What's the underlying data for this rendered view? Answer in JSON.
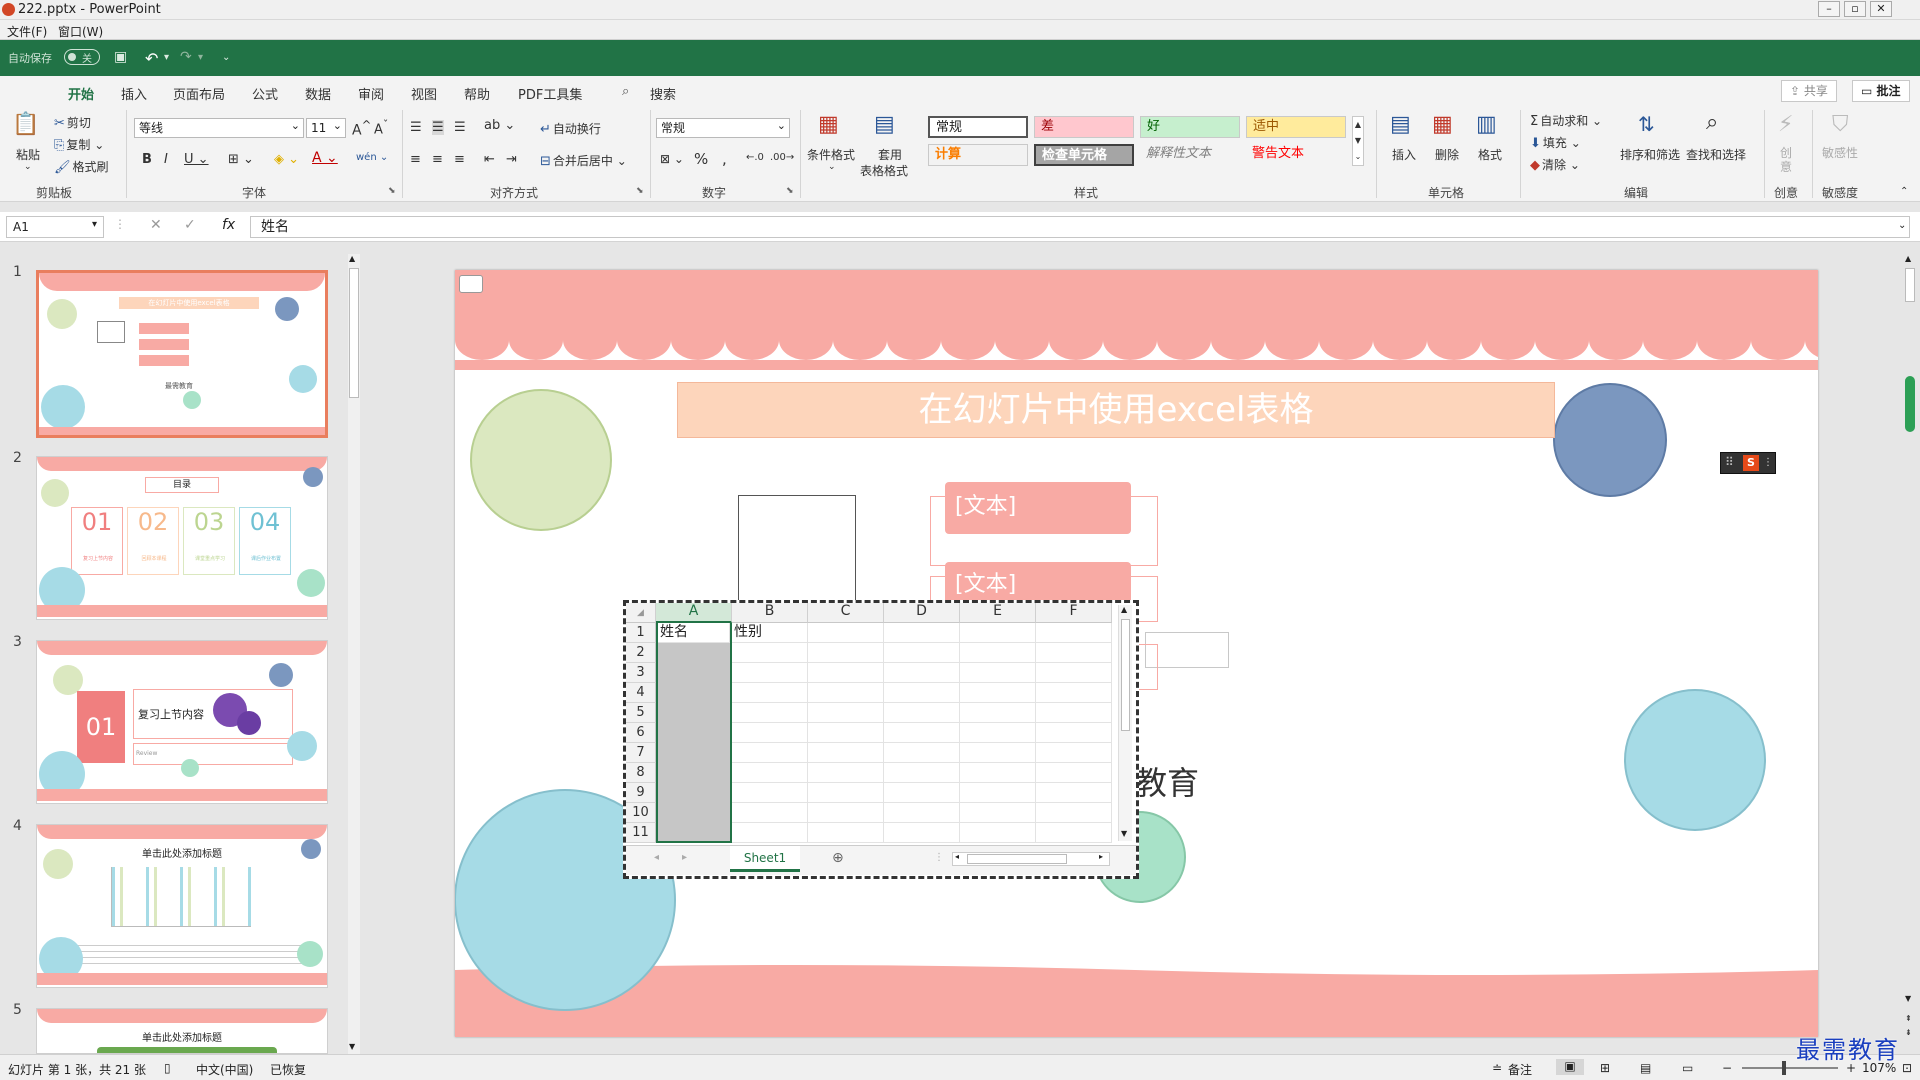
{
  "window": {
    "title": "222.pptx - PowerPoint"
  },
  "menubar": {
    "file": "文件(F)",
    "window": "窗口(W)"
  },
  "qat": {
    "autosave": "自动保存",
    "toggle": "关"
  },
  "tabs": [
    "开始",
    "插入",
    "页面布局",
    "公式",
    "数据",
    "审阅",
    "视图",
    "帮助",
    "PDF工具集"
  ],
  "search": "搜索",
  "share": "共享",
  "comments": "批注",
  "ribbon": {
    "clipboard": {
      "paste": "粘贴",
      "cut": "剪切",
      "copy": "复制",
      "painter": "格式刷",
      "label": "剪贴板"
    },
    "font": {
      "name": "等线",
      "size": "11",
      "label": "字体"
    },
    "align": {
      "wrap": "自动换行",
      "merge": "合并后居中",
      "label": "对齐方式"
    },
    "number": {
      "format": "常规",
      "label": "数字"
    },
    "styles": {
      "cond": "条件格式",
      "table1": "套用",
      "table2": "表格格式",
      "normal": "常规",
      "bad": "差",
      "good": "好",
      "neutral": "适中",
      "calc": "计算",
      "check": "检查单元格",
      "explain": "解释性文本",
      "warn": "警告文本",
      "label": "样式"
    },
    "cells": {
      "insert": "插入",
      "delete": "删除",
      "format": "格式",
      "label": "单元格"
    },
    "edit": {
      "autosum": "自动求和",
      "fill": "填充",
      "clear": "清除",
      "sort": "排序和筛选",
      "find": "查找和选择",
      "label": "编辑"
    },
    "create": {
      "btn": "创意",
      "label": "创意"
    },
    "sens": {
      "btn": "敏感性",
      "label": "敏感度"
    }
  },
  "formula": {
    "namebox": "A1",
    "value": "姓名"
  },
  "thumbs": {
    "nums": [
      "1",
      "2",
      "3",
      "4",
      "5"
    ],
    "t1": {
      "title": "在幻灯片中使用excel表格",
      "sub": "最需教育"
    },
    "t2": {
      "title": "目录",
      "n1": "01",
      "n2": "02",
      "n3": "03",
      "n4": "04",
      "c1": "复习上节内容",
      "c2": "回顾本课程",
      "c3": "课堂重点学习",
      "c4": "课后作业布置"
    },
    "t3": {
      "n": "01",
      "title": "复习上节内容",
      "sub": "Review"
    },
    "t4": {
      "title": "单击此处添加标题"
    },
    "t5": {
      "title": "单击此处添加标题"
    }
  },
  "slide": {
    "title": "在幻灯片中使用excel表格",
    "box1": "[文本]",
    "box2": "[文本]",
    "edu": "教育"
  },
  "excel": {
    "cols": [
      "A",
      "B",
      "C",
      "D",
      "E",
      "F"
    ],
    "rows": [
      "1",
      "2",
      "3",
      "4",
      "5",
      "6",
      "7",
      "8",
      "9",
      "10",
      "11"
    ],
    "a1": "姓名",
    "b1": "性别",
    "sheet": "Sheet1"
  },
  "status": {
    "slide": "幻灯片 第 1 张，共 21 张",
    "lang": "中文(中国)",
    "recovered": "已恢复",
    "notes": "备注",
    "zoom": "107%"
  },
  "watermark": "最需教育",
  "colors": {
    "excel_green": "#217346",
    "slide_pink": "#f8aaa4",
    "title_peach": "#fdd5bb",
    "accent_orange": "#e97e5e"
  }
}
